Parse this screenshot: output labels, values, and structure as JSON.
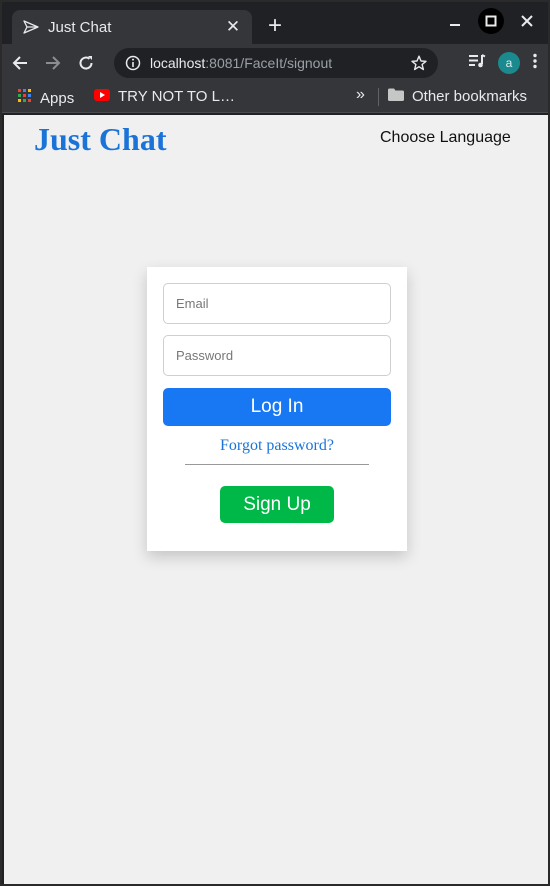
{
  "browser": {
    "tab": {
      "title": "Just Chat",
      "favicon": "paper-plane-icon"
    },
    "new_tab_label": "+",
    "url": {
      "host": "localhost",
      "rest": ":8081/FaceIt/signout"
    },
    "profile_initial": "a",
    "bookmarks": {
      "apps_label": "Apps",
      "youtube_label": "TRY NOT TO L…",
      "more_label": "»",
      "other_label": "Other bookmarks"
    }
  },
  "page": {
    "brand": "Just Chat",
    "language_link": "Choose Language",
    "login": {
      "email_placeholder": "Email",
      "password_placeholder": "Password",
      "login_button": "Log In",
      "forgot_link": "Forgot password?",
      "signup_button": "Sign Up"
    }
  },
  "colors": {
    "brand": "#1a73d9",
    "login_button": "#1877f2",
    "signup_button": "#00b847",
    "page_background": "#f0f0f0"
  }
}
